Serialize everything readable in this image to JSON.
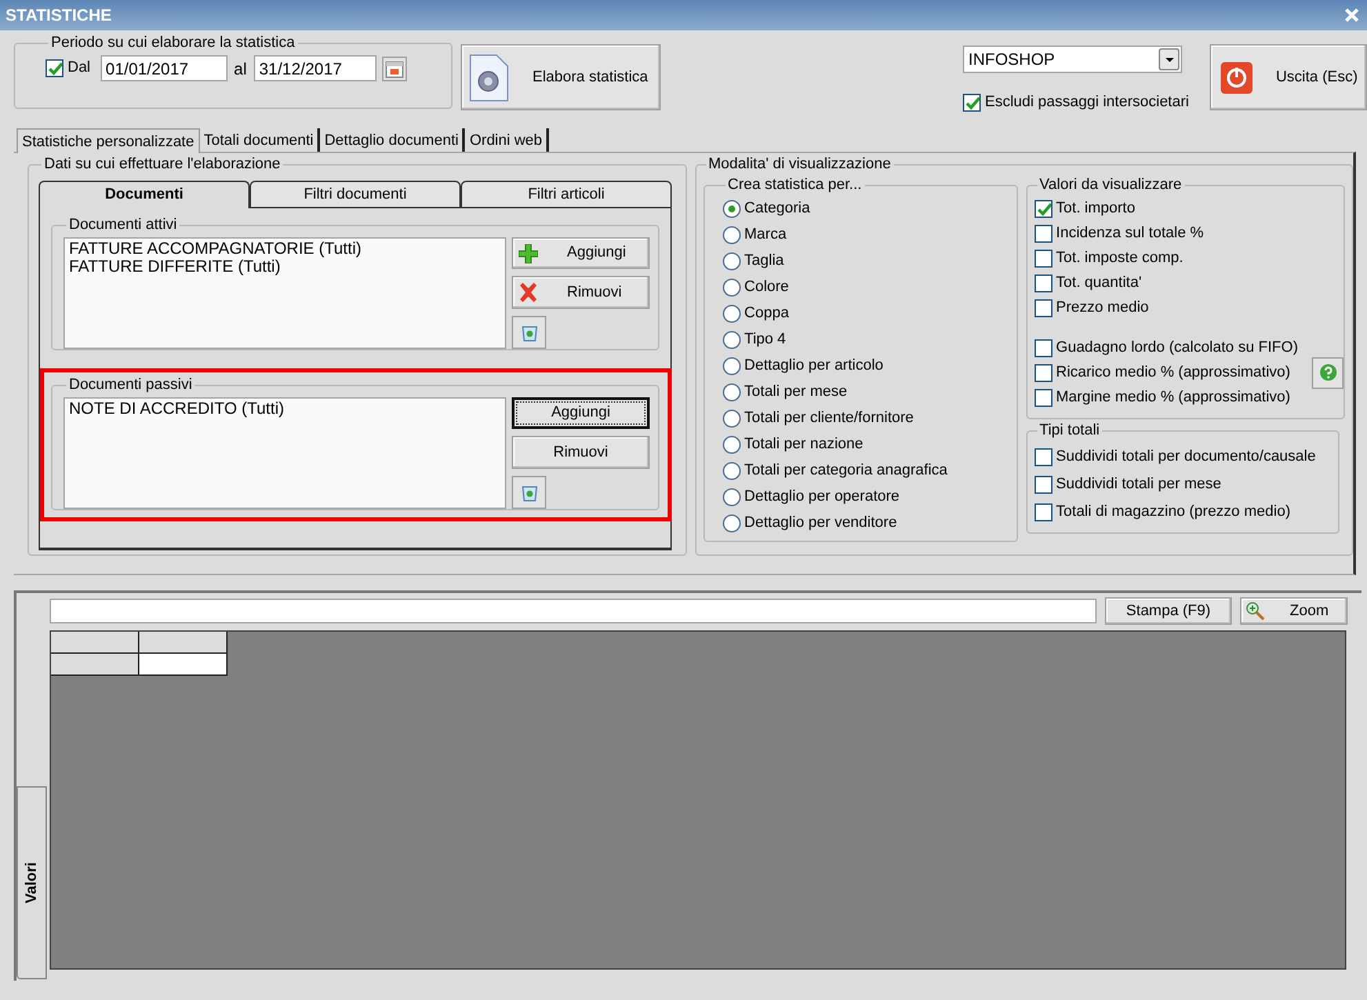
{
  "window": {
    "title": "STATISTICHE"
  },
  "period": {
    "legend": "Periodo su cui elaborare la statistica",
    "from_check": {
      "label": "Dal",
      "checked": true
    },
    "from": "01/01/2017",
    "to_label": "al",
    "to": "31/12/2017"
  },
  "process_button": "Elabora statistica",
  "company": {
    "value": "INFOSHOP"
  },
  "exclude_intercompany": {
    "label": "Escludi passaggi intersocietari",
    "checked": true
  },
  "exit_button": "Uscita (Esc)",
  "tabs": [
    {
      "label": "Statistiche personalizzate",
      "selected": true
    },
    {
      "label": "Totali documenti",
      "selected": false
    },
    {
      "label": "Dettaglio documenti",
      "selected": false
    },
    {
      "label": "Ordini web",
      "selected": false
    }
  ],
  "data_group": {
    "legend": "Dati su cui effettuare l'elaborazione",
    "tabs": [
      {
        "label": "Documenti",
        "selected": true
      },
      {
        "label": "Filtri documenti",
        "selected": false
      },
      {
        "label": "Filtri articoli",
        "selected": false
      }
    ],
    "sections": [
      {
        "legend": "Documenti attivi",
        "highlighted": false,
        "items": [
          "FATTURE ACCOMPAGNATORIE (Tutti)",
          "FATTURE DIFFERITE (Tutti)"
        ],
        "buttons": [
          {
            "label": "Aggiungi",
            "kind": "add",
            "focused": false
          },
          {
            "label": "Rimuovi",
            "kind": "remove",
            "focused": false
          }
        ]
      },
      {
        "legend": "Documenti passivi",
        "highlighted": true,
        "items": [
          "NOTE DI ACCREDITO (Tutti)"
        ],
        "buttons": [
          {
            "label": "Aggiungi",
            "kind": "plain",
            "focused": true
          },
          {
            "label": "Rimuovi",
            "kind": "plain",
            "focused": false
          }
        ]
      }
    ]
  },
  "display": {
    "legend": "Modalita' di visualizzazione",
    "group_by": {
      "legend": "Crea statistica per...",
      "options": [
        {
          "label": "Categoria",
          "selected": true
        },
        {
          "label": "Marca",
          "selected": false
        },
        {
          "label": "Taglia",
          "selected": false
        },
        {
          "label": "Colore",
          "selected": false
        },
        {
          "label": "Coppa",
          "selected": false
        },
        {
          "label": "Tipo 4",
          "selected": false
        },
        {
          "label": "Dettaglio per articolo",
          "selected": false
        },
        {
          "label": "Totali per mese",
          "selected": false
        },
        {
          "label": "Totali per cliente/fornitore",
          "selected": false
        },
        {
          "label": "Totali per nazione",
          "selected": false
        },
        {
          "label": "Totali per categoria anagrafica",
          "selected": false
        },
        {
          "label": "Dettaglio per operatore",
          "selected": false
        },
        {
          "label": "Dettaglio per venditore",
          "selected": false
        }
      ]
    },
    "values": {
      "legend": "Valori da visualizzare",
      "options": [
        {
          "label": "Tot. importo",
          "checked": true
        },
        {
          "label": "Incidenza sul totale %",
          "checked": false
        },
        {
          "label": "Tot. imposte comp.",
          "checked": false
        },
        {
          "label": "Tot. quantita'",
          "checked": false
        },
        {
          "label": "Prezzo medio",
          "checked": false
        }
      ],
      "margin_options": [
        {
          "label": "Guadagno lordo (calcolato su FIFO)",
          "checked": false
        },
        {
          "label": "Ricarico medio % (approssimativo)",
          "checked": false
        },
        {
          "label": "Margine medio % (approssimativo)",
          "checked": false
        }
      ]
    },
    "totals": {
      "legend": "Tipi totali",
      "options": [
        {
          "label": "Suddividi totali per documento/causale",
          "checked": false
        },
        {
          "label": "Suddividi totali per mese",
          "checked": false
        },
        {
          "label": "Totali di magazzino (prezzo medio)",
          "checked": false
        }
      ]
    }
  },
  "results": {
    "buttons": [
      {
        "label": "Stampa (F9)",
        "kind": "print"
      },
      {
        "label": "Zoom",
        "kind": "zoom"
      }
    ],
    "side_tab": "Valori"
  }
}
